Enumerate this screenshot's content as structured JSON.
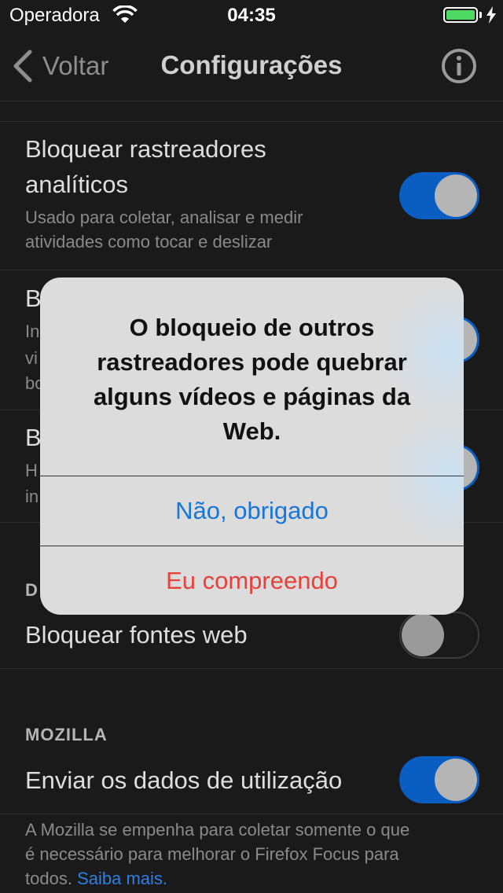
{
  "status_bar": {
    "carrier": "Operadora",
    "time": "04:35",
    "battery_percent": 100
  },
  "nav": {
    "back_label": "Voltar",
    "title": "Configurações",
    "info_icon": "info-icon"
  },
  "settings": {
    "analytics": {
      "title_line1": "Bloquear rastreadores",
      "title_line2": "analíticos",
      "desc_line1": "Usado para coletar, analisar e medir",
      "desc_line2": "atividades como tocar e deslizar",
      "enabled": true
    },
    "partial_rows": [
      {
        "title_start": "B",
        "desc_starts": [
          "In",
          "vi",
          "bo"
        ],
        "enabled": true
      },
      {
        "title_start": "B",
        "desc_starts": [
          "H",
          "in"
        ],
        "enabled": true
      }
    ],
    "section_partial": "D",
    "web_fonts": {
      "title": "Bloquear fontes web",
      "enabled": false
    },
    "mozilla_section": "MOZILLA",
    "usage_data": {
      "title": "Enviar os dados de utilização",
      "enabled": true
    },
    "footer": {
      "line1": "A Mozilla se empenha para coletar somente o que",
      "line2": "é necessário para melhorar o Firefox Focus para",
      "line3_prefix": "todos.",
      "link": "Saiba mais."
    }
  },
  "alert": {
    "message_lines": [
      "O bloqueio de outros",
      "rastreadores pode quebrar",
      "alguns vídeos e páginas da",
      "Web."
    ],
    "cancel_label": "Não, obrigado",
    "confirm_label": "Eu compreendo"
  },
  "colors": {
    "background": "#1a1a1a",
    "toggle_on": "#0a5ec2",
    "alert_bg": "#dcdcdc",
    "primary_action": "#1776d9",
    "destructive_action": "#e8413a",
    "link": "#2e7fe0"
  }
}
